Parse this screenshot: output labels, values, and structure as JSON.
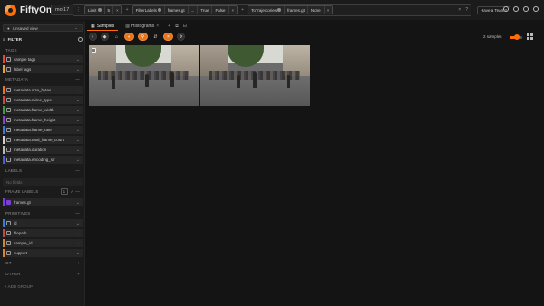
{
  "app": {
    "name": "FiftyOne",
    "dataset": "mot17",
    "team_button": "Have a Team?"
  },
  "view_bar": {
    "stages": [
      {
        "name": "Limit",
        "value": "5"
      },
      {
        "name": "FilterLabels",
        "field": "frames.gt",
        "extra": "...",
        "v1": "True",
        "v2": "False"
      },
      {
        "name": "ToTrajectories",
        "field": "frames.gt",
        "value": "None"
      }
    ]
  },
  "sidebar": {
    "view_select": "Unsaved view",
    "filter_title": "FILTER",
    "sections": {
      "tags": "TAGS",
      "metadata": "METADATA",
      "labels": "LABELS",
      "frame_labels": "FRAME LABELS",
      "primitives": "PRIMITIVES",
      "gt": "GT",
      "other": "OTHER"
    },
    "tags": [
      "sample tags",
      "label tags"
    ],
    "metadata": [
      "metadata.size_bytes",
      "metadata.mime_type",
      "metadata.frame_width",
      "metadata.frame_height",
      "metadata.frame_rate",
      "metadata.total_frame_count",
      "metadata.duration",
      "metadata.encoding_str"
    ],
    "no_labels": "No fields",
    "frame_labels_count": "1",
    "frame_labels": [
      "frames.gt"
    ],
    "primitives": [
      "id",
      "filepath",
      "sample_id",
      "support"
    ],
    "add_group": "+ ADD GROUP"
  },
  "main": {
    "tabs": [
      "Samples",
      "Histograms"
    ],
    "sample_count": "2 samples"
  },
  "colors": {
    "accent": "#ff6d04",
    "tag_sample": "#e0493a",
    "tag_label": "#e8a23c",
    "metadata": [
      "#e8741b",
      "#c64b3e",
      "#3e9a43",
      "#7c4bc2",
      "#3a7ad1",
      "#cfcfcf",
      "#b8b8b8",
      "#4a5fd0"
    ],
    "frames_gt": "#7a3fd8",
    "primitives": [
      "#3b7bd6",
      "#b84b4b",
      "#c98a2e",
      "#e0802a"
    ]
  },
  "zoom": {
    "level": 0.6
  }
}
